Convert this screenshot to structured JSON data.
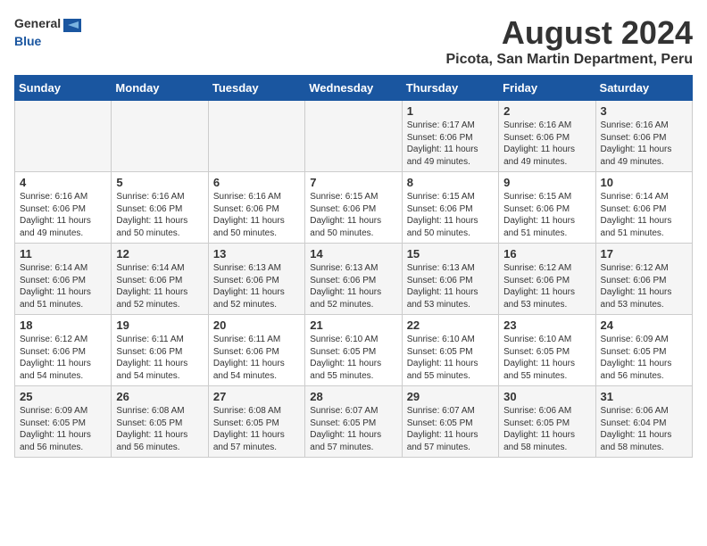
{
  "header": {
    "logo_general": "General",
    "logo_blue": "Blue",
    "month_year": "August 2024",
    "location": "Picota, San Martin Department, Peru"
  },
  "days_of_week": [
    "Sunday",
    "Monday",
    "Tuesday",
    "Wednesday",
    "Thursday",
    "Friday",
    "Saturday"
  ],
  "weeks": [
    [
      {
        "day": "",
        "info": ""
      },
      {
        "day": "",
        "info": ""
      },
      {
        "day": "",
        "info": ""
      },
      {
        "day": "",
        "info": ""
      },
      {
        "day": "1",
        "info": "Sunrise: 6:17 AM\nSunset: 6:06 PM\nDaylight: 11 hours\nand 49 minutes."
      },
      {
        "day": "2",
        "info": "Sunrise: 6:16 AM\nSunset: 6:06 PM\nDaylight: 11 hours\nand 49 minutes."
      },
      {
        "day": "3",
        "info": "Sunrise: 6:16 AM\nSunset: 6:06 PM\nDaylight: 11 hours\nand 49 minutes."
      }
    ],
    [
      {
        "day": "4",
        "info": "Sunrise: 6:16 AM\nSunset: 6:06 PM\nDaylight: 11 hours\nand 49 minutes."
      },
      {
        "day": "5",
        "info": "Sunrise: 6:16 AM\nSunset: 6:06 PM\nDaylight: 11 hours\nand 50 minutes."
      },
      {
        "day": "6",
        "info": "Sunrise: 6:16 AM\nSunset: 6:06 PM\nDaylight: 11 hours\nand 50 minutes."
      },
      {
        "day": "7",
        "info": "Sunrise: 6:15 AM\nSunset: 6:06 PM\nDaylight: 11 hours\nand 50 minutes."
      },
      {
        "day": "8",
        "info": "Sunrise: 6:15 AM\nSunset: 6:06 PM\nDaylight: 11 hours\nand 50 minutes."
      },
      {
        "day": "9",
        "info": "Sunrise: 6:15 AM\nSunset: 6:06 PM\nDaylight: 11 hours\nand 51 minutes."
      },
      {
        "day": "10",
        "info": "Sunrise: 6:14 AM\nSunset: 6:06 PM\nDaylight: 11 hours\nand 51 minutes."
      }
    ],
    [
      {
        "day": "11",
        "info": "Sunrise: 6:14 AM\nSunset: 6:06 PM\nDaylight: 11 hours\nand 51 minutes."
      },
      {
        "day": "12",
        "info": "Sunrise: 6:14 AM\nSunset: 6:06 PM\nDaylight: 11 hours\nand 52 minutes."
      },
      {
        "day": "13",
        "info": "Sunrise: 6:13 AM\nSunset: 6:06 PM\nDaylight: 11 hours\nand 52 minutes."
      },
      {
        "day": "14",
        "info": "Sunrise: 6:13 AM\nSunset: 6:06 PM\nDaylight: 11 hours\nand 52 minutes."
      },
      {
        "day": "15",
        "info": "Sunrise: 6:13 AM\nSunset: 6:06 PM\nDaylight: 11 hours\nand 53 minutes."
      },
      {
        "day": "16",
        "info": "Sunrise: 6:12 AM\nSunset: 6:06 PM\nDaylight: 11 hours\nand 53 minutes."
      },
      {
        "day": "17",
        "info": "Sunrise: 6:12 AM\nSunset: 6:06 PM\nDaylight: 11 hours\nand 53 minutes."
      }
    ],
    [
      {
        "day": "18",
        "info": "Sunrise: 6:12 AM\nSunset: 6:06 PM\nDaylight: 11 hours\nand 54 minutes."
      },
      {
        "day": "19",
        "info": "Sunrise: 6:11 AM\nSunset: 6:06 PM\nDaylight: 11 hours\nand 54 minutes."
      },
      {
        "day": "20",
        "info": "Sunrise: 6:11 AM\nSunset: 6:06 PM\nDaylight: 11 hours\nand 54 minutes."
      },
      {
        "day": "21",
        "info": "Sunrise: 6:10 AM\nSunset: 6:05 PM\nDaylight: 11 hours\nand 55 minutes."
      },
      {
        "day": "22",
        "info": "Sunrise: 6:10 AM\nSunset: 6:05 PM\nDaylight: 11 hours\nand 55 minutes."
      },
      {
        "day": "23",
        "info": "Sunrise: 6:10 AM\nSunset: 6:05 PM\nDaylight: 11 hours\nand 55 minutes."
      },
      {
        "day": "24",
        "info": "Sunrise: 6:09 AM\nSunset: 6:05 PM\nDaylight: 11 hours\nand 56 minutes."
      }
    ],
    [
      {
        "day": "25",
        "info": "Sunrise: 6:09 AM\nSunset: 6:05 PM\nDaylight: 11 hours\nand 56 minutes."
      },
      {
        "day": "26",
        "info": "Sunrise: 6:08 AM\nSunset: 6:05 PM\nDaylight: 11 hours\nand 56 minutes."
      },
      {
        "day": "27",
        "info": "Sunrise: 6:08 AM\nSunset: 6:05 PM\nDaylight: 11 hours\nand 57 minutes."
      },
      {
        "day": "28",
        "info": "Sunrise: 6:07 AM\nSunset: 6:05 PM\nDaylight: 11 hours\nand 57 minutes."
      },
      {
        "day": "29",
        "info": "Sunrise: 6:07 AM\nSunset: 6:05 PM\nDaylight: 11 hours\nand 57 minutes."
      },
      {
        "day": "30",
        "info": "Sunrise: 6:06 AM\nSunset: 6:05 PM\nDaylight: 11 hours\nand 58 minutes."
      },
      {
        "day": "31",
        "info": "Sunrise: 6:06 AM\nSunset: 6:04 PM\nDaylight: 11 hours\nand 58 minutes."
      }
    ]
  ]
}
